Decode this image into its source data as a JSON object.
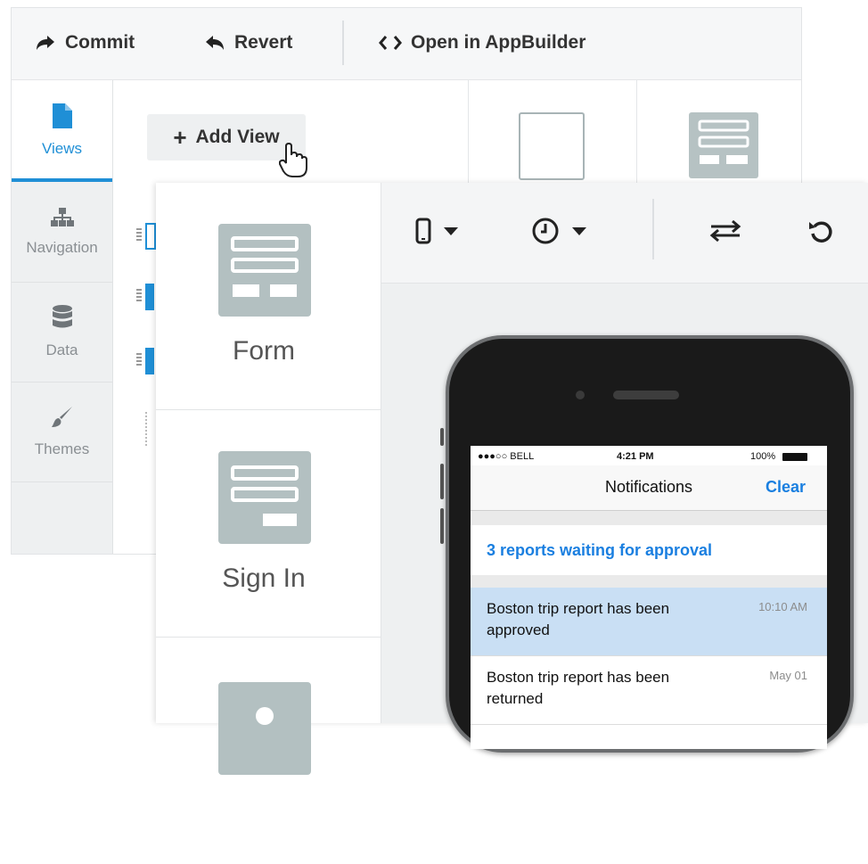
{
  "toolbar": {
    "commit_label": "Commit",
    "revert_label": "Revert",
    "open_label": "Open in AppBuilder"
  },
  "sidebar": {
    "items": [
      {
        "label": "Views",
        "icon": "file-icon",
        "active": true
      },
      {
        "label": "Navigation",
        "icon": "sitemap-icon",
        "active": false
      },
      {
        "label": "Data",
        "icon": "database-icon",
        "active": false
      },
      {
        "label": "Themes",
        "icon": "brush-icon",
        "active": false
      }
    ]
  },
  "views": {
    "add_view_label": "Add View"
  },
  "templates": [
    {
      "label": "Form",
      "icon": "form-template-icon"
    },
    {
      "label": "Sign In",
      "icon": "sign-in-template-icon"
    },
    {
      "label": "",
      "icon": "about-template-icon"
    }
  ],
  "preview_toolbar": {
    "icons": [
      "phone-icon",
      "clock-icon",
      "swap-icon",
      "refresh-icon"
    ]
  },
  "phone": {
    "status": {
      "carrier": "●●●○○ BELL",
      "time": "4:21 PM",
      "battery": "100%"
    },
    "nav_title": "Notifications",
    "nav_action": "Clear",
    "pending": "3 reports waiting for approval",
    "notifications": [
      {
        "text": "Boston trip report has been approved",
        "time": "10:10 AM",
        "highlighted": true
      },
      {
        "text": "Boston trip report has been returned",
        "time": "May 01",
        "highlighted": false
      }
    ]
  },
  "colors": {
    "accent": "#1f8fd6",
    "ios_blue": "#1a7fe0",
    "template_gray": "#b3c0c1",
    "highlight_row": "#c9dff4"
  }
}
